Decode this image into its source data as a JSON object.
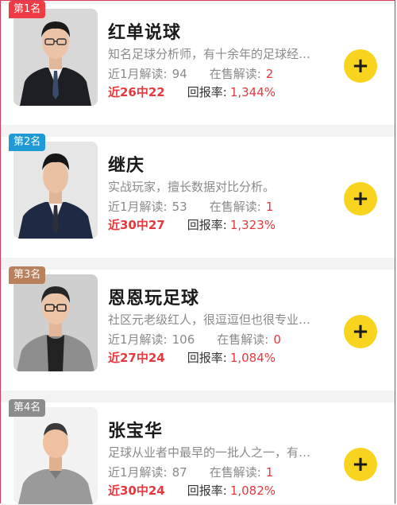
{
  "labels": {
    "recent_label": "近1月解读:",
    "onsale_label": "在售解读:",
    "return_label": "回报率:",
    "add_icon": "+"
  },
  "experts": [
    {
      "rank": "第1名",
      "name": "红单说球",
      "desc": "知名足球分析师，有十余年的足球经…",
      "recent": "94",
      "onsale": "2",
      "streak": "近26中22",
      "return_rate": "1,344%"
    },
    {
      "rank": "第2名",
      "name": "继庆",
      "desc": "实战玩家，擅长数据对比分析。",
      "recent": "53",
      "onsale": "1",
      "streak": "近30中27",
      "return_rate": "1,323%"
    },
    {
      "rank": "第3名",
      "name": "恩恩玩足球",
      "desc": "社区元老级红人，很逗逗但也很专业…",
      "recent": "106",
      "onsale": "0",
      "streak": "近27中24",
      "return_rate": "1,084%"
    },
    {
      "rank": "第4名",
      "name": "张宝华",
      "desc": "足球从业者中最早的一批人之一，有…",
      "recent": "87",
      "onsale": "1",
      "streak": "近30中24",
      "return_rate": "1,082%"
    }
  ]
}
